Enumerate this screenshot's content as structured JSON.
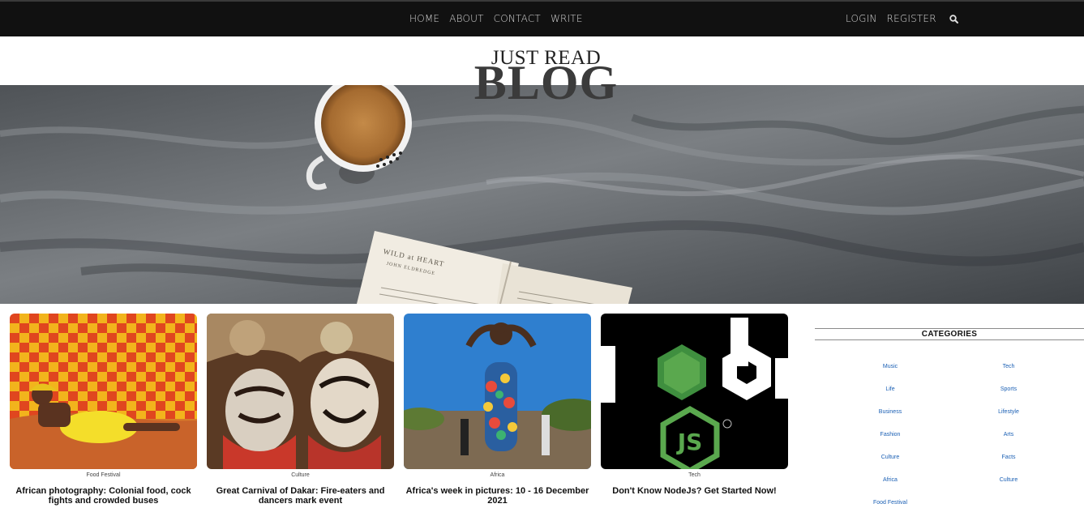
{
  "nav": {
    "home": "HOME",
    "about": "ABOUT",
    "contact": "CONTACT",
    "write": "WRITE",
    "login": "LOGIN",
    "register": "REGISTER",
    "search_icon": "search-icon"
  },
  "header": {
    "title_small": "JUST READ",
    "title_large": "BLOG"
  },
  "hero": {
    "book_title": "WILD at HEART",
    "book_author": "JOHN ELDREDGE"
  },
  "posts": [
    {
      "category": "Food Festival",
      "title": "African photography: Colonial food, cock fights and crowded buses"
    },
    {
      "category": "Culture",
      "title": "Great Carnival of Dakar: Fire-eaters and dancers mark event"
    },
    {
      "category": "Africa",
      "title": "Africa's week in pictures: 10 - 16 December 2021"
    },
    {
      "category": "Tech",
      "title": "Don't Know NodeJs? Get Started Now!"
    }
  ],
  "sidebar": {
    "title": "CATEGORIES",
    "categories_left": [
      "Music",
      "Life",
      "Business",
      "Fashion",
      "Culture",
      "Africa",
      "Food Festival"
    ],
    "categories_right": [
      "Tech",
      "Sports",
      "Lifestyle",
      "Arts",
      "Facts",
      "Culture"
    ]
  },
  "colors": {
    "nav_bg": "#111111",
    "category_link": "#1a5fb4",
    "node_green": "#68a063"
  }
}
